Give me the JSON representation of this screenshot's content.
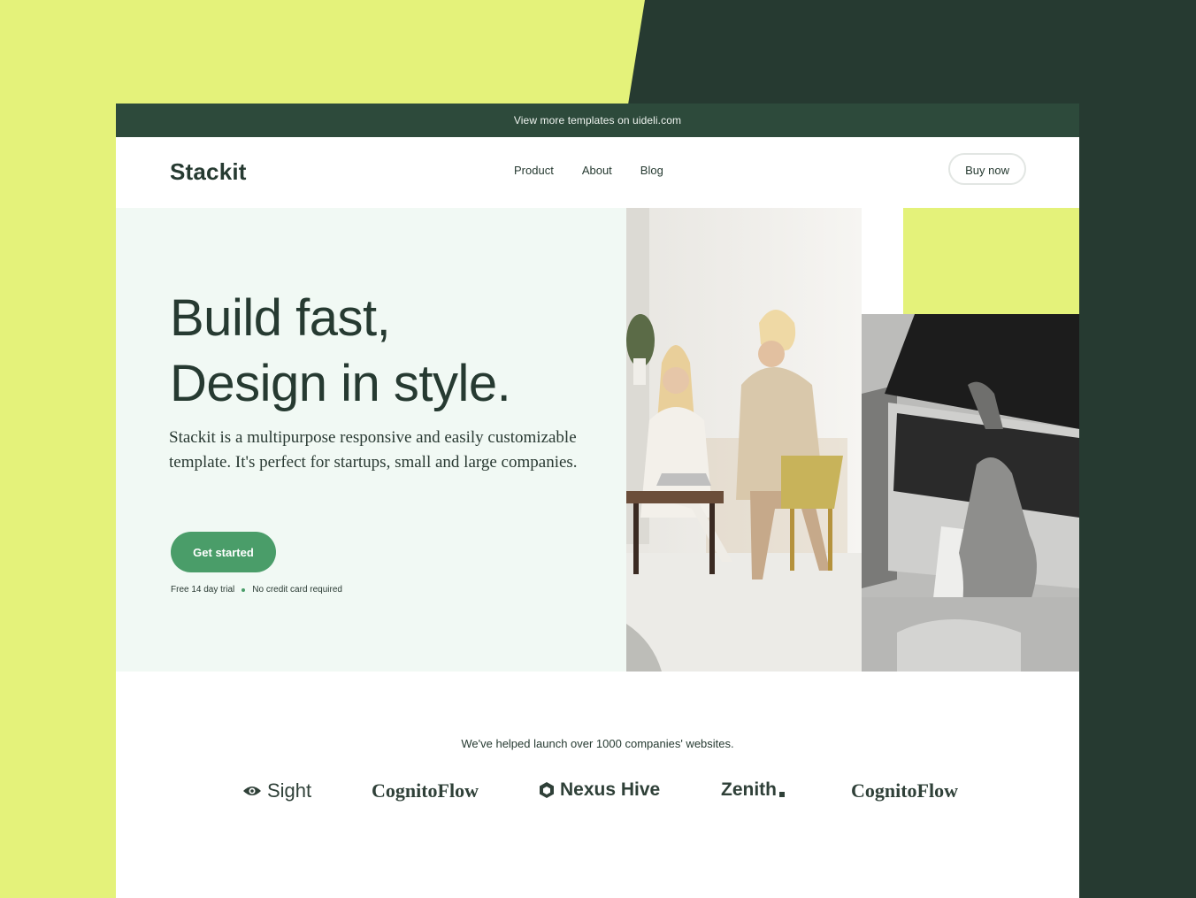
{
  "promo": {
    "text": "View more templates on uideli.com"
  },
  "header": {
    "logo": "Stackit",
    "nav": [
      "Product",
      "About",
      "Blog"
    ],
    "cta": "Buy now"
  },
  "hero": {
    "title_line1": "Build fast,",
    "title_line2": "Design in style.",
    "description": "Stackit is a multipurpose responsive and easily customizable template. It's perfect for startups, small and large companies.",
    "cta": "Get started",
    "note1": "Free 14 day trial",
    "note2": "No credit card required"
  },
  "logos": {
    "tagline": "We've helped launch over 1000 companies' websites.",
    "brands": [
      "Sight",
      "CognitoFlow",
      "Nexus Hive",
      "Zenith",
      "CognitoFlow"
    ]
  },
  "colors": {
    "lime": "#e4f27a",
    "dark_green": "#263a31",
    "banner": "#2d4a3b",
    "hero_bg": "#f1f9f4",
    "cta_green": "#4a9d69"
  }
}
